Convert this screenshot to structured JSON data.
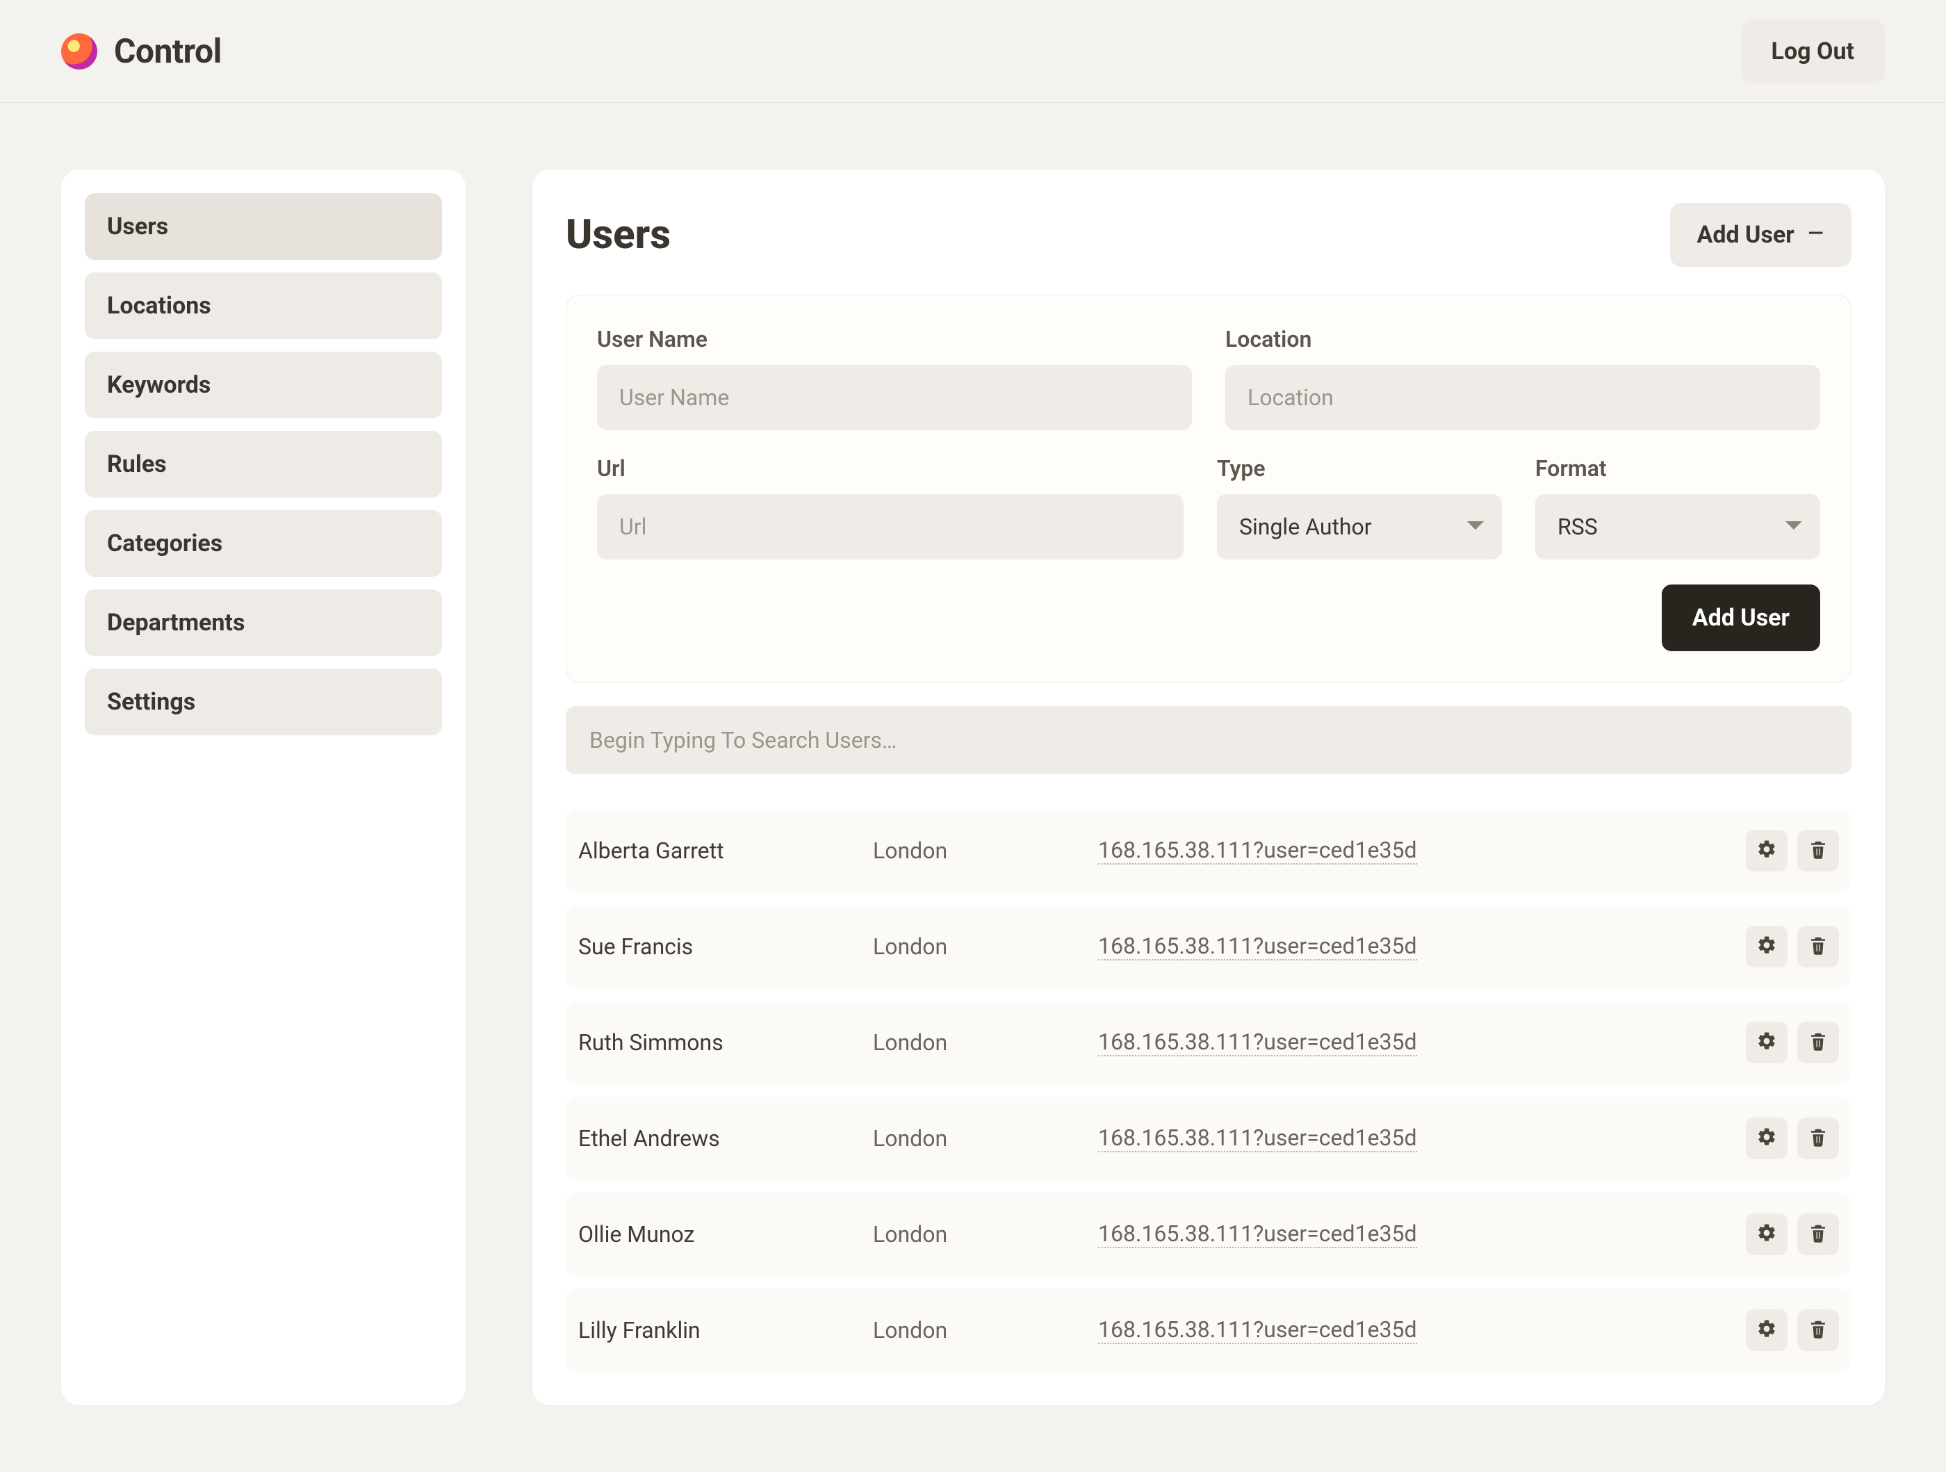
{
  "brand": {
    "name": "Control"
  },
  "header": {
    "logout": "Log Out"
  },
  "sidebar": {
    "items": [
      {
        "label": "Users",
        "active": true
      },
      {
        "label": "Locations",
        "active": false
      },
      {
        "label": "Keywords",
        "active": false
      },
      {
        "label": "Rules",
        "active": false
      },
      {
        "label": "Categories",
        "active": false
      },
      {
        "label": "Departments",
        "active": false
      },
      {
        "label": "Settings",
        "active": false
      }
    ]
  },
  "main": {
    "title": "Users",
    "add_user_toggle": "Add User",
    "form": {
      "labels": {
        "user_name": "User Name",
        "location": "Location",
        "url": "Url",
        "type": "Type",
        "format": "Format"
      },
      "placeholders": {
        "user_name": "User Name",
        "location": "Location",
        "url": "Url"
      },
      "type_value": "Single Author",
      "format_value": "RSS",
      "submit": "Add User"
    },
    "search_placeholder": "Begin Typing To Search Users…",
    "users": [
      {
        "name": "Alberta Garrett",
        "location": "London",
        "url": "168.165.38.111?user=ced1e35d"
      },
      {
        "name": "Sue Francis",
        "location": "London",
        "url": "168.165.38.111?user=ced1e35d"
      },
      {
        "name": "Ruth Simmons",
        "location": "London",
        "url": "168.165.38.111?user=ced1e35d"
      },
      {
        "name": "Ethel Andrews",
        "location": "London",
        "url": "168.165.38.111?user=ced1e35d"
      },
      {
        "name": "Ollie Munoz",
        "location": "London",
        "url": "168.165.38.111?user=ced1e35d"
      },
      {
        "name": "Lilly Franklin",
        "location": "London",
        "url": "168.165.38.111?user=ced1e35d"
      }
    ]
  }
}
